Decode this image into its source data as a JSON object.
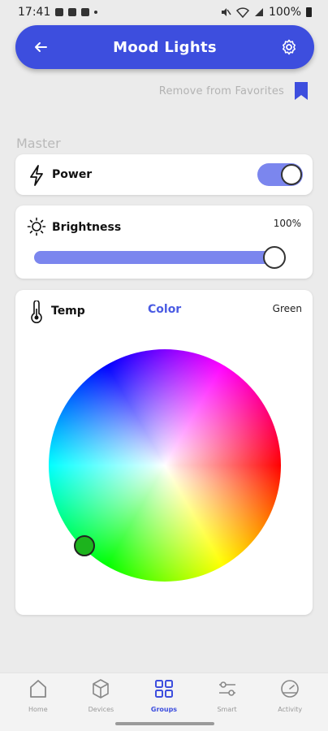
{
  "status_bar": {
    "time": "17:41",
    "battery": "100%"
  },
  "header": {
    "title": "Mood Lights"
  },
  "favorites": {
    "label": "Remove from Favorites"
  },
  "master": {
    "label": "Master"
  },
  "power": {
    "label": "Power",
    "on": true
  },
  "brightness": {
    "label": "Brightness",
    "value_text": "100%",
    "value": 1.0
  },
  "color_card": {
    "tab_temp": "Temp",
    "tab_color": "Color",
    "selected_color": "Green",
    "picker_color": "#1db31d",
    "picker_hue_deg": 135,
    "picker_saturation": 0.98
  },
  "colors": {
    "accent": "#3d4ede",
    "accent_light": "#7b86ee",
    "background": "#ebebeb"
  },
  "bottom_nav": {
    "items": [
      {
        "label": "Home",
        "icon": "home-icon"
      },
      {
        "label": "Devices",
        "icon": "cube-icon"
      },
      {
        "label": "Groups",
        "icon": "grid-icon"
      },
      {
        "label": "Smart",
        "icon": "sliders-icon"
      },
      {
        "label": "Activity",
        "icon": "gauge-icon"
      }
    ],
    "active_index": 2
  }
}
